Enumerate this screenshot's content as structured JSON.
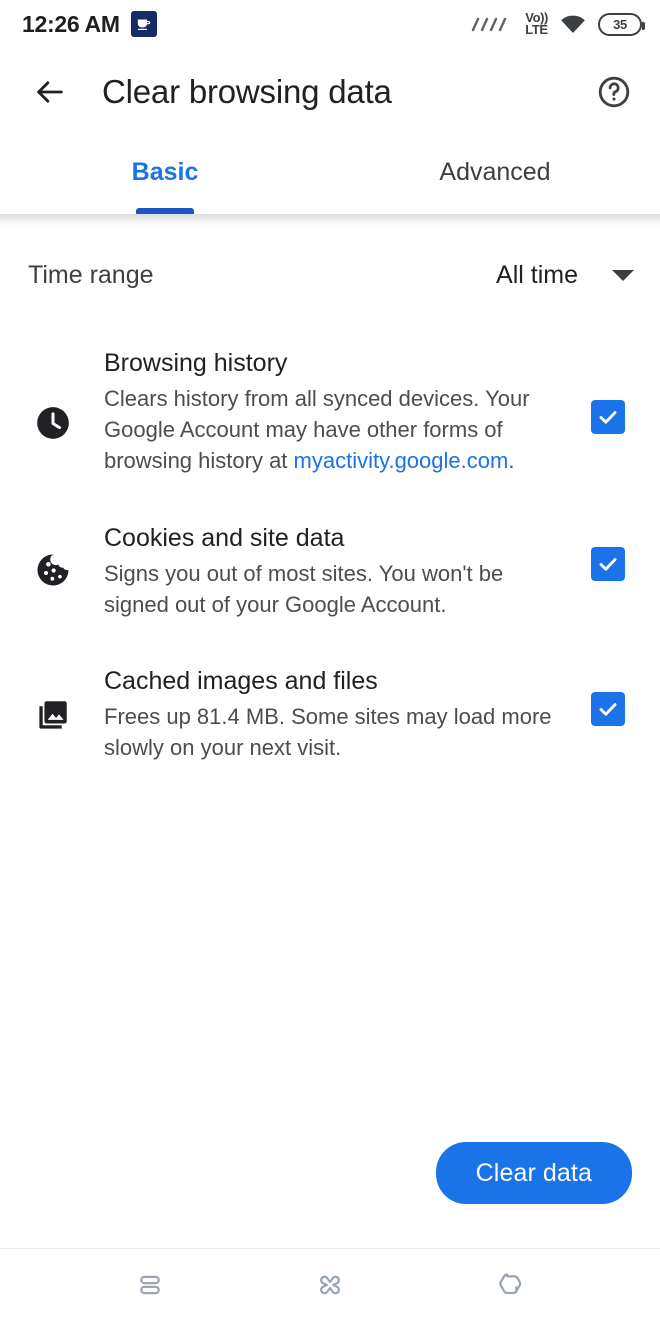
{
  "status_bar": {
    "clock": "12:26 AM",
    "app_badge_icon": "cup-icon",
    "signal_icon": "signal-bars-icon",
    "network_line1": "Vo))",
    "network_line2": "LTE",
    "wifi_icon": "wifi-icon",
    "battery_level": "35"
  },
  "app_bar": {
    "back_icon": "back-arrow-icon",
    "title": "Clear browsing data",
    "help_icon": "help-circle-icon"
  },
  "tabs": {
    "items": [
      {
        "label": "Basic",
        "active": true
      },
      {
        "label": "Advanced",
        "active": false
      }
    ]
  },
  "time_range": {
    "label": "Time range",
    "value": "All time",
    "caret_icon": "chevron-down-icon"
  },
  "options": [
    {
      "icon": "clock-icon",
      "title": "Browsing history",
      "desc_before": "Clears history from all synced devices. Your Google Account may have other forms of browsing history at ",
      "link": "myactivity.google.com",
      "desc_after": ".",
      "checked": true
    },
    {
      "icon": "cookie-icon",
      "title": "Cookies and site data",
      "desc_before": "Signs you out of most sites. You won't be signed out of your Google Account.",
      "link": "",
      "desc_after": "",
      "checked": true
    },
    {
      "icon": "photo-library-icon",
      "title": "Cached images and files",
      "desc_before": "Frees up 81.4 MB. Some sites may load more slowly on your next visit.",
      "link": "",
      "desc_after": "",
      "checked": true
    }
  ],
  "primary_action": {
    "label": "Clear data"
  },
  "nav_bar": {
    "items": [
      {
        "icon": "recents-icon"
      },
      {
        "icon": "home-icon"
      },
      {
        "icon": "back-nav-icon"
      }
    ]
  },
  "colors": {
    "accent": "#1a73e8",
    "tab_indicator": "#1a56c4",
    "text_primary": "#202124",
    "text_secondary": "#4a4d51",
    "nav_icon": "#9aa5b1",
    "badge_bg": "#152B63"
  }
}
